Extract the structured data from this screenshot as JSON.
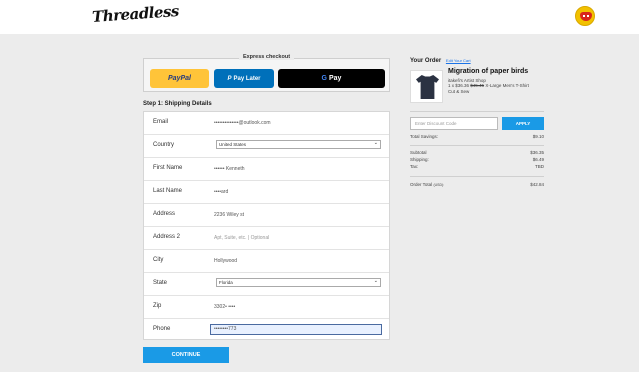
{
  "header": {
    "logo_text": "Threadless"
  },
  "express": {
    "title": "Express checkout",
    "paypal_label": "PayPal",
    "paylater_label": "Pay Later",
    "gpay_label": "Pay"
  },
  "step": {
    "title": "Step 1: Shipping Details"
  },
  "form": {
    "email_label": "Email",
    "email_value": "••••••••••••••@outlook.com",
    "country_label": "Country",
    "country_value": "United States",
    "first_name_label": "First Name",
    "first_name_value": "•••••• Kenneth",
    "last_name_label": "Last Name",
    "last_name_value": "••••ard",
    "address_label": "Address",
    "address_value": "2236 Wiley st",
    "address2_label": "Address 2",
    "address2_placeholder": "Apt, Suite, etc. | Optional",
    "city_label": "City",
    "city_value": "Hollywood",
    "state_label": "State",
    "state_value": "Florida",
    "zip_label": "Zip",
    "zip_value": "3302• ••••",
    "phone_label": "Phone",
    "phone_value": "••••••••773"
  },
  "continue_label": "CONTINUE",
  "order": {
    "title": "Your Order",
    "edit_cart": "Edit Your Cart",
    "product_name": "Migration of paper birds",
    "shop": "itakefi's Artist Shop",
    "line_prefix": "1 x $36.36",
    "line_old_price": "$45.45",
    "line_suffix": "X-Large Men's T-Shirt",
    "line_color": "Cut & Sew",
    "discount_placeholder": "Enter Discount Code",
    "apply_label": "APPLY",
    "total_savings_label": "Total Savings:",
    "total_savings_value": "$9.10",
    "subtotal_label": "Subtotal",
    "subtotal_value": "$36.35",
    "shipping_label": "Shipping:",
    "shipping_value": "$6.49",
    "tax_label": "Tax:",
    "tax_value": "TBD",
    "order_total_label": "Order Total",
    "order_total_currency": "(USD):",
    "order_total_value": "$42.84"
  },
  "colors": {
    "accent": "#1a9ae6",
    "paypal": "#ffc439",
    "paylater": "#0070ba"
  }
}
